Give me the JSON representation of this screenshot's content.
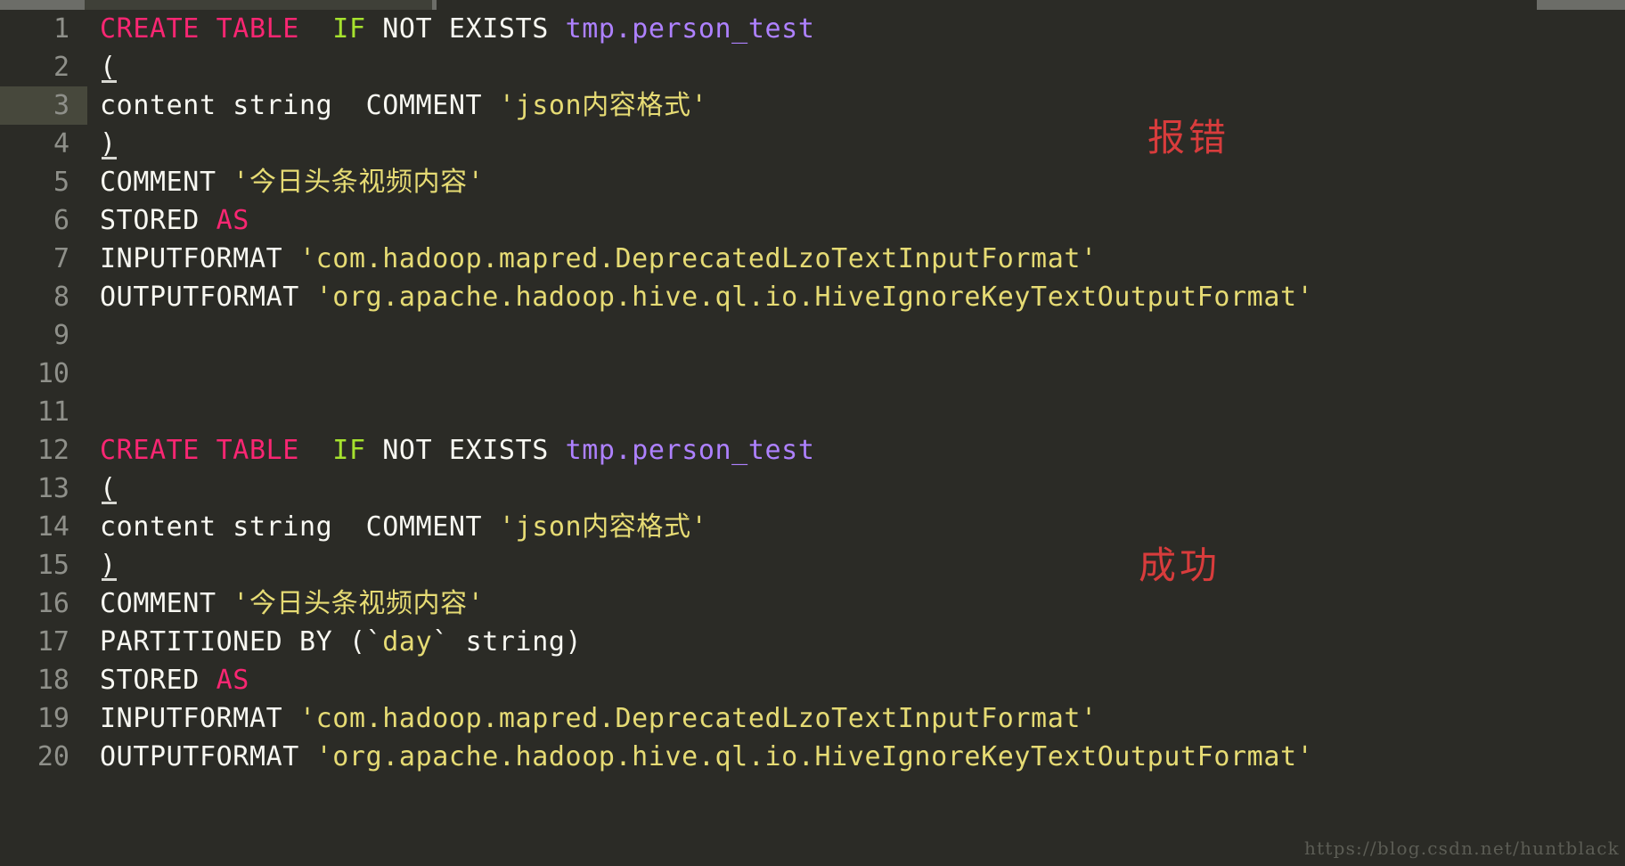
{
  "window": {
    "background_color": "#2b2b26",
    "tabstrip_color": "#6c6d68",
    "active_tab_color": "#3f4038"
  },
  "theme": {
    "name": "monokai-like",
    "keyword_color": "#f92672",
    "conditional_color": "#a6e22e",
    "identifier_color": "#ae81ff",
    "string_color": "#e6db74",
    "plain_color": "#f8f8f2",
    "line_number_color": "#8f908a",
    "current_line_color": "#47483c",
    "annotation_color": "#d83c3c"
  },
  "editor": {
    "current_line": 3,
    "lines": [
      {
        "number": "1",
        "tokens": [
          {
            "text": "CREATE TABLE ",
            "cls": "t-kw"
          },
          {
            "text": " ",
            "cls": "t-plain"
          },
          {
            "text": "IF",
            "cls": "t-cond"
          },
          {
            "text": " NOT EXISTS ",
            "cls": "t-plain"
          },
          {
            "text": "tmp.person_test",
            "cls": "t-id"
          }
        ]
      },
      {
        "number": "2",
        "tokens": [
          {
            "text": "(",
            "cls": "t-plain"
          }
        ]
      },
      {
        "number": "3",
        "tokens": [
          {
            "text": "content string  COMMENT ",
            "cls": "t-plain"
          },
          {
            "text": "'json内容格式'",
            "cls": "t-str"
          }
        ]
      },
      {
        "number": "4",
        "tokens": [
          {
            "text": ")",
            "cls": "t-plain"
          }
        ]
      },
      {
        "number": "5",
        "tokens": [
          {
            "text": "COMMENT ",
            "cls": "t-plain"
          },
          {
            "text": "'今日头条视频内容'",
            "cls": "t-str"
          }
        ]
      },
      {
        "number": "6",
        "tokens": [
          {
            "text": "STORED ",
            "cls": "t-plain"
          },
          {
            "text": "AS",
            "cls": "t-kw"
          }
        ]
      },
      {
        "number": "7",
        "tokens": [
          {
            "text": "INPUTFORMAT ",
            "cls": "t-plain"
          },
          {
            "text": "'com.hadoop.mapred.DeprecatedLzoTextInputFormat'",
            "cls": "t-str"
          }
        ]
      },
      {
        "number": "8",
        "tokens": [
          {
            "text": "OUTPUTFORMAT ",
            "cls": "t-plain"
          },
          {
            "text": "'org.apache.hadoop.hive.ql.io.HiveIgnoreKeyTextOutputFormat'",
            "cls": "t-str"
          }
        ]
      },
      {
        "number": "9",
        "tokens": []
      },
      {
        "number": "10",
        "tokens": []
      },
      {
        "number": "11",
        "tokens": []
      },
      {
        "number": "12",
        "tokens": [
          {
            "text": "CREATE TABLE ",
            "cls": "t-kw"
          },
          {
            "text": " ",
            "cls": "t-plain"
          },
          {
            "text": "IF",
            "cls": "t-cond"
          },
          {
            "text": " NOT EXISTS ",
            "cls": "t-plain"
          },
          {
            "text": "tmp.person_test",
            "cls": "t-id"
          }
        ]
      },
      {
        "number": "13",
        "tokens": [
          {
            "text": "(",
            "cls": "t-plain"
          }
        ]
      },
      {
        "number": "14",
        "tokens": [
          {
            "text": "content string  COMMENT ",
            "cls": "t-plain"
          },
          {
            "text": "'json内容格式'",
            "cls": "t-str"
          }
        ]
      },
      {
        "number": "15",
        "tokens": [
          {
            "text": ")",
            "cls": "t-plain"
          }
        ]
      },
      {
        "number": "16",
        "tokens": [
          {
            "text": "COMMENT ",
            "cls": "t-plain"
          },
          {
            "text": "'今日头条视频内容'",
            "cls": "t-str"
          }
        ]
      },
      {
        "number": "17",
        "tokens": [
          {
            "text": "PARTITIONED BY (`",
            "cls": "t-plain"
          },
          {
            "text": "day",
            "cls": "t-str"
          },
          {
            "text": "` string)",
            "cls": "t-plain"
          }
        ]
      },
      {
        "number": "18",
        "tokens": [
          {
            "text": "STORED ",
            "cls": "t-plain"
          },
          {
            "text": "AS",
            "cls": "t-kw"
          }
        ]
      },
      {
        "number": "19",
        "tokens": [
          {
            "text": "INPUTFORMAT ",
            "cls": "t-plain"
          },
          {
            "text": "'com.hadoop.mapred.DeprecatedLzoTextInputFormat'",
            "cls": "t-str"
          }
        ]
      },
      {
        "number": "20",
        "tokens": [
          {
            "text": "OUTPUTFORMAT ",
            "cls": "t-plain"
          },
          {
            "text": "'org.apache.hadoop.hive.ql.io.HiveIgnoreKeyTextOutputFormat'",
            "cls": "t-str"
          }
        ]
      }
    ]
  },
  "annotations": [
    {
      "id": "error",
      "text": "报错",
      "near_line": "4"
    },
    {
      "id": "success",
      "text": "成功",
      "near_line": "15"
    }
  ],
  "watermark": {
    "text": "https://blog.csdn.net/huntblack"
  }
}
